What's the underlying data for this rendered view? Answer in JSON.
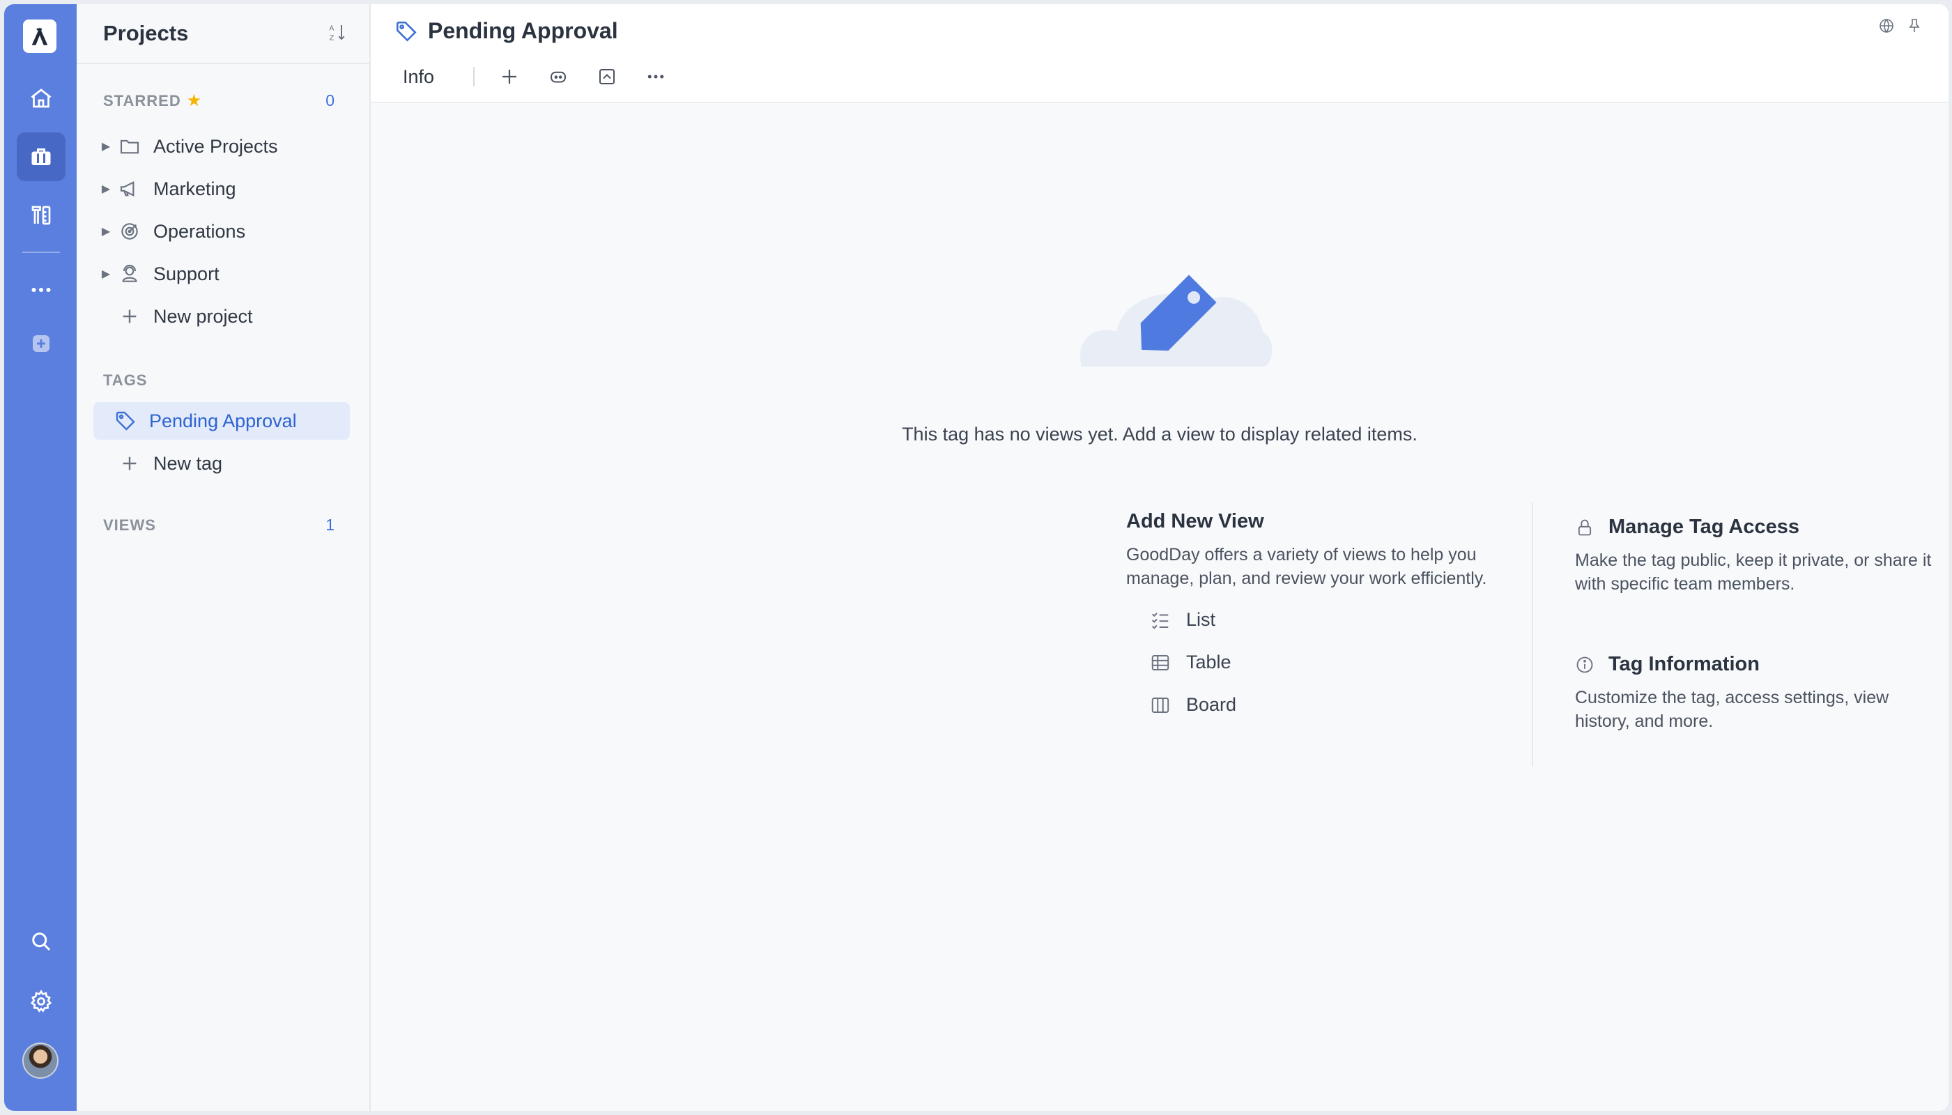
{
  "panel": {
    "title": "Projects",
    "starred": {
      "label": "STARRED",
      "count": "0"
    },
    "projects": [
      {
        "label": "Active Projects",
        "icon": "folder-icon"
      },
      {
        "label": "Marketing",
        "icon": "megaphone-icon"
      },
      {
        "label": "Operations",
        "icon": "target-icon"
      },
      {
        "label": "Support",
        "icon": "support-agent-icon"
      }
    ],
    "new_project_label": "New project",
    "tags": {
      "label": "TAGS",
      "items": [
        {
          "label": "Pending Approval",
          "icon": "tag-icon"
        }
      ]
    },
    "new_tag_label": "New tag",
    "views": {
      "label": "VIEWS",
      "count": "1"
    }
  },
  "header": {
    "title": "Pending Approval",
    "tab_info": "Info"
  },
  "empty_state": {
    "message": "This tag has no views yet. Add a view to display related items.",
    "add_view": {
      "title": "Add New View",
      "description": "GoodDay offers a variety of views to help you manage, plan, and review your work efficiently.",
      "options": [
        {
          "label": "List",
          "icon": "list-icon"
        },
        {
          "label": "Table",
          "icon": "table-icon"
        },
        {
          "label": "Board",
          "icon": "board-icon"
        }
      ]
    },
    "manage_access": {
      "title": "Manage Tag Access",
      "description": "Make the tag public, keep it private, or share it with specific team members."
    },
    "tag_info": {
      "title": "Tag Information",
      "description": "Customize the tag, access settings, view history, and more."
    }
  },
  "colors": {
    "rail": "#5b7fde",
    "accent": "#3d6fd8",
    "selected_bg": "#e3ebfb",
    "star": "#f4b400"
  }
}
